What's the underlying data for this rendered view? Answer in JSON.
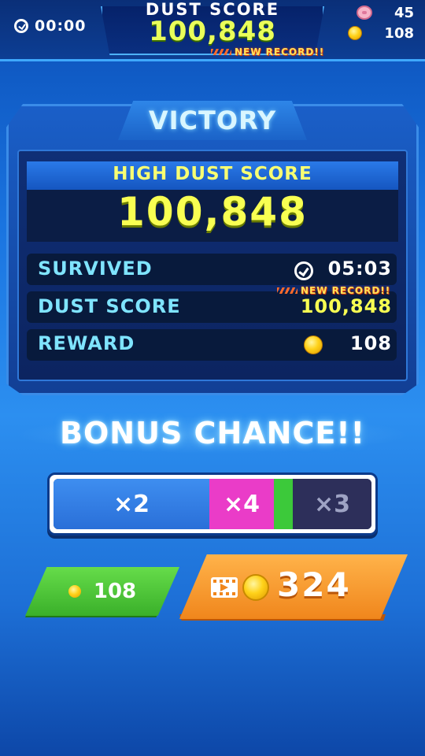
{
  "hud": {
    "timer": "00:00",
    "score_label": "DUST SCORE",
    "score_value": "100,848",
    "new_record": "NEW RECORD!!",
    "pig_count": "45",
    "coin_count": "108"
  },
  "result": {
    "title": "VICTORY",
    "high_label": "HIGH DUST SCORE",
    "high_value": "100,848",
    "rows": [
      {
        "label": "SURVIVED",
        "value": "05:03",
        "icon": "clock-icon"
      },
      {
        "label": "DUST SCORE",
        "value": "100,848",
        "badge": "NEW RECORD!!"
      },
      {
        "label": "REWARD",
        "value": "108",
        "icon": "coin-icon"
      }
    ]
  },
  "bonus": {
    "title": "BONUS CHANCE!!",
    "segments": [
      {
        "label": "×2",
        "color": "#3e8ef0"
      },
      {
        "label": "×4",
        "color": "#ea3cc8"
      },
      {
        "label": "",
        "color": "#3cc93a"
      },
      {
        "label": "×3",
        "color": "#2d2f5a"
      }
    ]
  },
  "buttons": {
    "collect_value": "108",
    "video_value": "324"
  },
  "colors": {
    "accent_yellow": "#f8ff52",
    "label_cyan": "#7fe4ff",
    "button_green": "#3ab02a",
    "button_orange": "#f0861c"
  }
}
